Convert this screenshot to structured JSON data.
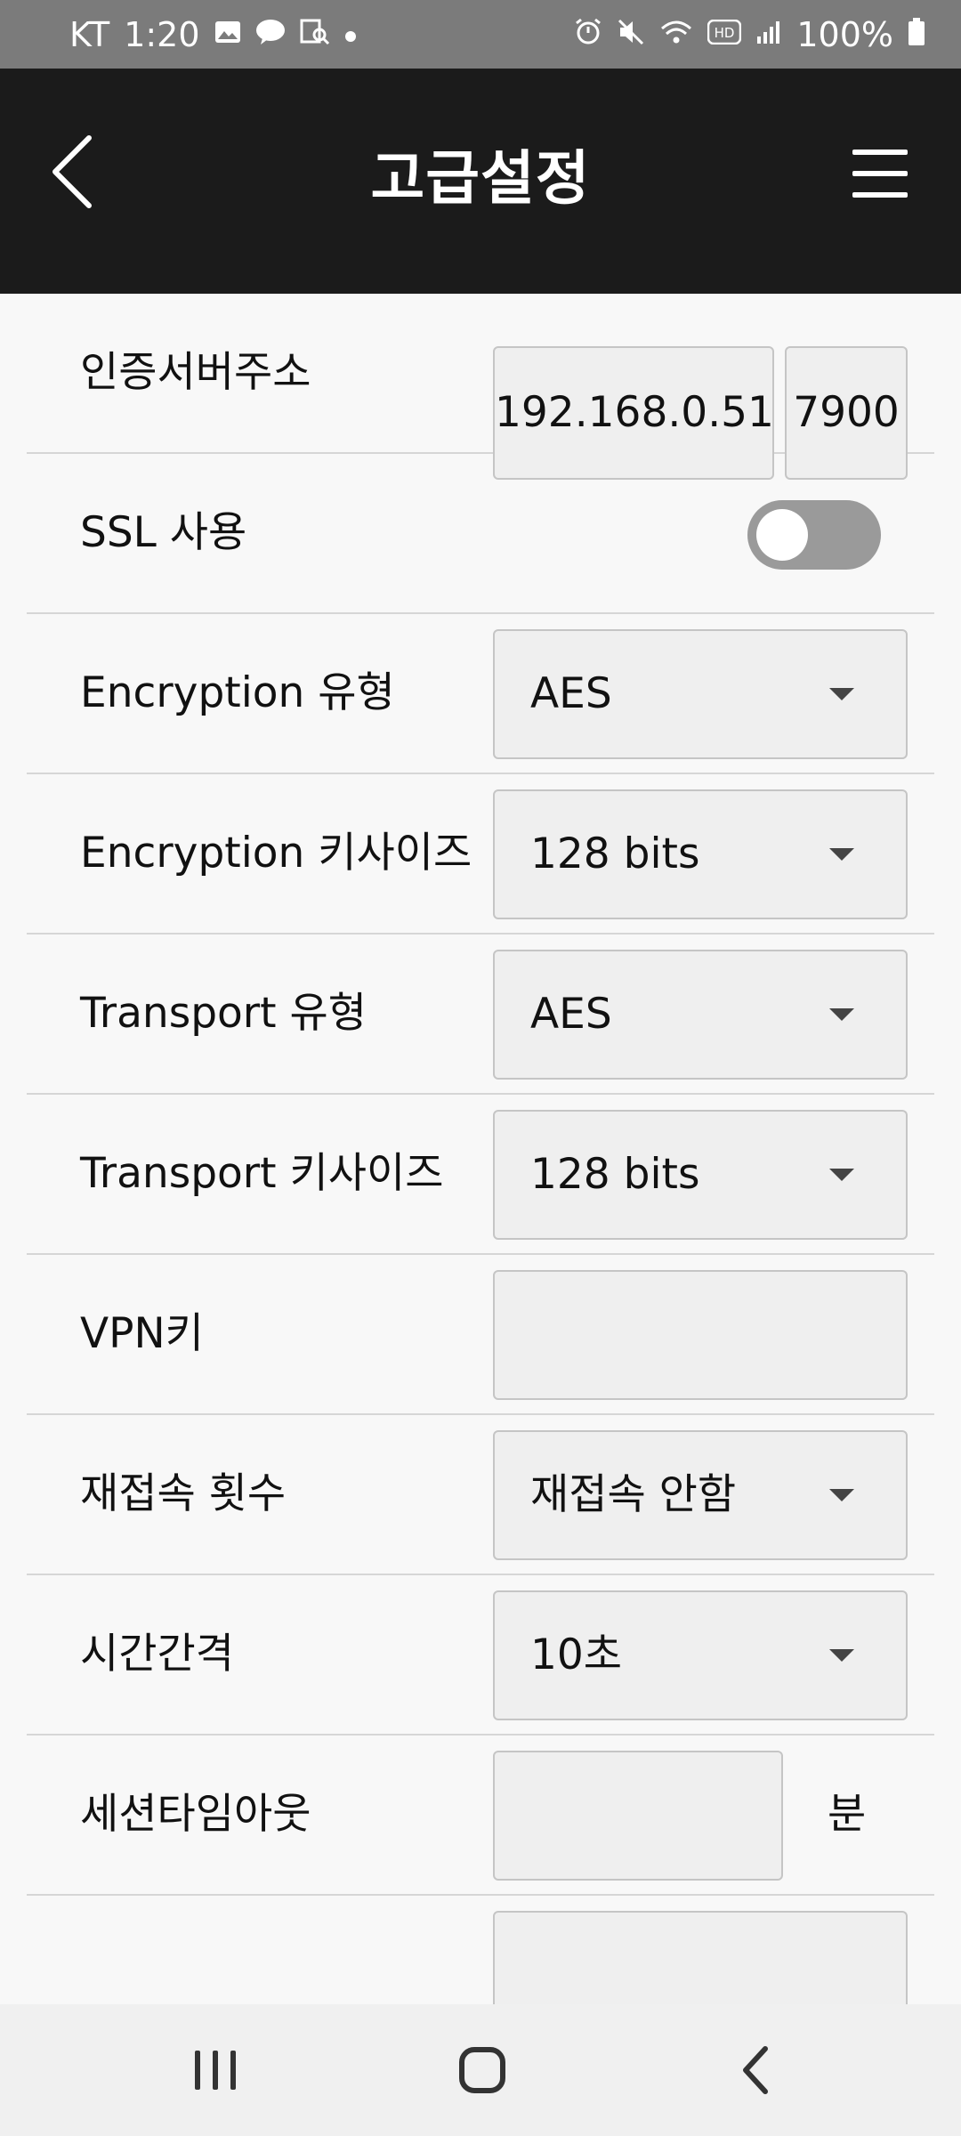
{
  "status_bar": {
    "carrier": "KT",
    "time": "1:20",
    "battery": "100%",
    "left_icons": [
      "gallery-icon",
      "talk-icon",
      "search-doc-icon",
      "dot-icon"
    ],
    "right_icons": [
      "alarm-icon",
      "mute-icon",
      "wifi-icon",
      "hd-icon",
      "signal-icon",
      "battery-icon"
    ]
  },
  "header": {
    "title": "고급설정"
  },
  "settings": {
    "auth_server": {
      "label": "인증서버주소",
      "ip": "192.168.0.51",
      "port": "7900"
    },
    "ssl": {
      "label": "SSL 사용",
      "enabled": false
    },
    "enc_type": {
      "label": "Encryption 유형",
      "value": "AES"
    },
    "enc_keysize": {
      "label": "Encryption 키사이즈",
      "value": "128 bits"
    },
    "transport_type": {
      "label": "Transport 유형",
      "value": "AES"
    },
    "transport_keysize": {
      "label": "Transport 키사이즈",
      "value": "128 bits"
    },
    "vpn_key": {
      "label": "VPN키",
      "value": ""
    },
    "reconnect": {
      "label": "재접속 횟수",
      "value": "재접속 안함"
    },
    "interval": {
      "label": "시간간격",
      "value": "10초"
    },
    "session_timeout": {
      "label": "세션타임아웃",
      "value": "",
      "unit": "분"
    }
  },
  "colors": {
    "header_bg": "#1b1b1b",
    "statusbar_bg": "#7b7b7b",
    "field_bg": "#efefef",
    "toggle_off": "#9a9a9a"
  }
}
